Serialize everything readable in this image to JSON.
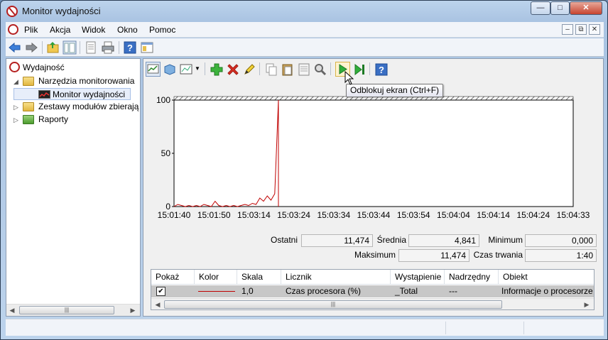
{
  "window": {
    "title": "Monitor wydajności"
  },
  "menu": {
    "items": [
      "Plik",
      "Akcja",
      "Widok",
      "Okno",
      "Pomoc"
    ]
  },
  "tree": {
    "root": "Wydajność",
    "monitoring_tools": "Narzędzia monitorowania",
    "perf_monitor": "Monitor wydajności",
    "data_collector_sets": "Zestawy modułów zbierają",
    "reports": "Raporty"
  },
  "tooltip": "Odblokuj ekran (Ctrl+F)",
  "graph": {
    "y_ticks": [
      "100",
      "50",
      "0"
    ],
    "x_ticks": [
      "15:01:40",
      "15:01:50",
      "15:03:14",
      "15:03:24",
      "15:03:34",
      "15:03:44",
      "15:03:54",
      "15:04:04",
      "15:04:14",
      "15:04:24",
      "15:04:33"
    ],
    "line_color": "#c00000",
    "samples": [
      0,
      2,
      1,
      0,
      1,
      0,
      1,
      0,
      2,
      1,
      0,
      5,
      1,
      0,
      1,
      0,
      1,
      0,
      1,
      2,
      1,
      3,
      2,
      8,
      5,
      10,
      6,
      12,
      100
    ]
  },
  "stats": {
    "last_label": "Ostatni",
    "last_value": "11,474",
    "avg_label": "Średnia",
    "avg_value": "4,841",
    "min_label": "Minimum",
    "min_value": "0,000",
    "max_label": "Maksimum",
    "max_value": "11,474",
    "duration_label": "Czas trwania",
    "duration_value": "1:40"
  },
  "counters": {
    "headers": [
      "Pokaż",
      "Kolor",
      "Skala",
      "Licznik",
      "Wystąpienie",
      "Nadrzędny",
      "Obiekt"
    ],
    "rows": [
      {
        "show": "✔",
        "scale": "1,0",
        "counter": "Czas procesora (%)",
        "instance": "_Total",
        "parent": "---",
        "object": "Informacje o procesorze"
      }
    ]
  }
}
